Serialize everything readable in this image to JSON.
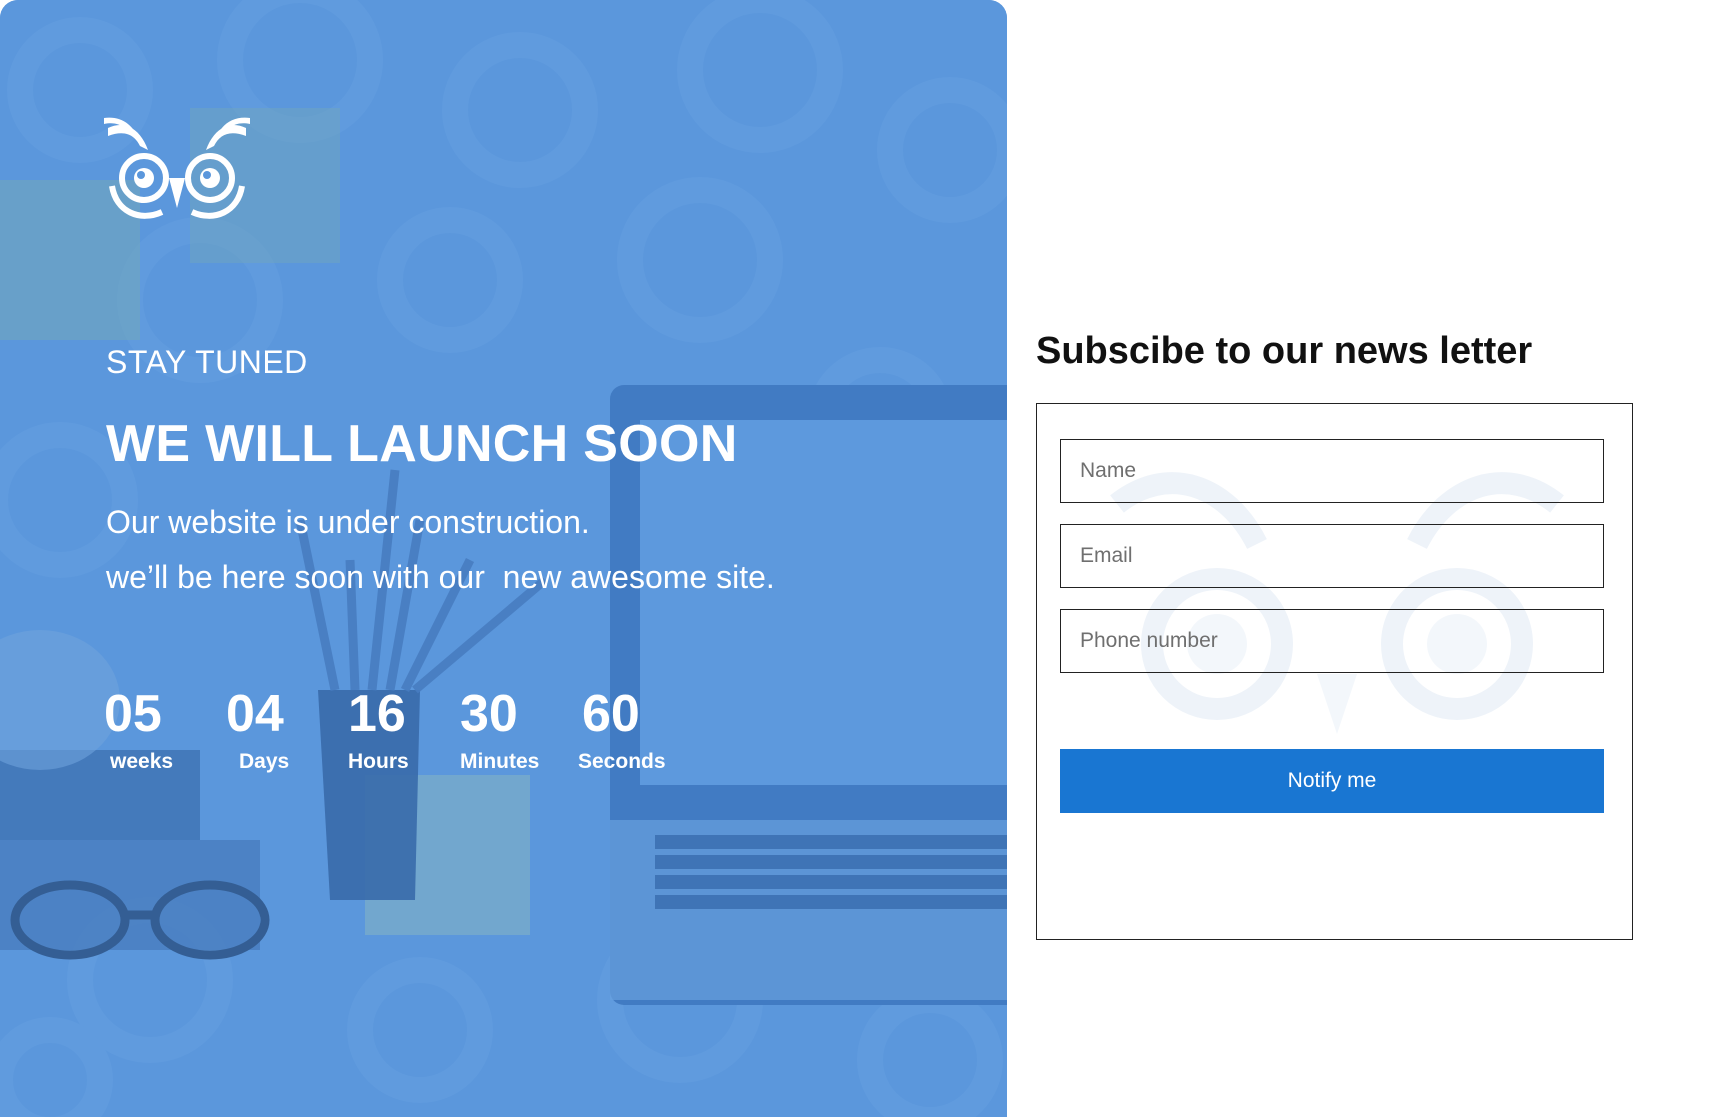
{
  "hero": {
    "eyebrow": "STAY TUNED",
    "title": "WE WILL LAUNCH SOON",
    "description_line1": "Our website is under construction.",
    "description_line2": "we’ll be here soon with our  new awesome site.",
    "logo_icon": "owl-logo-icon",
    "background_color": "#5b97dc"
  },
  "countdown": [
    {
      "value": "05",
      "label": "weeks"
    },
    {
      "value": "04",
      "label": "Days"
    },
    {
      "value": "16",
      "label": "Hours"
    },
    {
      "value": "30",
      "label": "Minutes"
    },
    {
      "value": "60",
      "label": "Seconds"
    }
  ],
  "subscribe": {
    "title": "Subscibe to our news letter",
    "name_placeholder": "Name",
    "email_placeholder": "Email",
    "phone_placeholder": "Phone number",
    "button_label": "Notify me",
    "button_color": "#1976d2"
  }
}
